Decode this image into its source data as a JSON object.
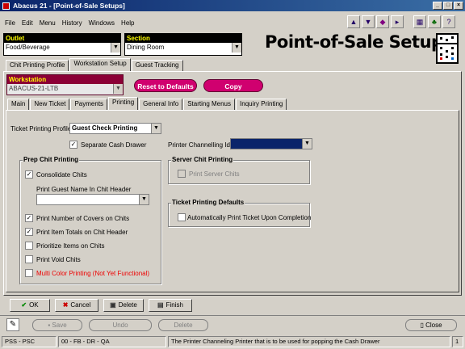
{
  "window": {
    "title": "Abacus 21 - [Point-of-Sale Setups]"
  },
  "menu": [
    "File",
    "Edit",
    "Menu",
    "History",
    "Windows",
    "Help"
  ],
  "header": {
    "outlet_label": "Outlet",
    "outlet_value": "Food/Beverage",
    "section_label": "Section",
    "section_value": "Dining Room",
    "page_title": "Point-of-Sale Setups"
  },
  "top_tabs": [
    "Chit Printing Profile",
    "Workstation Setup",
    "Guest Tracking"
  ],
  "workstation": {
    "label": "Workstation",
    "value": "ABACUS-21-LTB"
  },
  "actions": {
    "reset": "Reset to Defaults",
    "copy": "Copy"
  },
  "sub_tabs": [
    "Main",
    "New Ticket",
    "Payments",
    "Printing",
    "General Info",
    "Starting Menus",
    "Inquiry Printing"
  ],
  "form": {
    "ticket_profile_label": "Ticket Printing Profile",
    "ticket_profile_value": "Guest Check Printing",
    "separate_cash_drawer": "Separate Cash Drawer",
    "printer_channelling_label": "Printer Channelling Id",
    "prep": {
      "title": "Prep Chit Printing",
      "consolidate": "Consolidate Chits",
      "guest_name_label": "Print Guest Name In Chit Header",
      "covers": "Print Number of Covers on Chits",
      "item_totals": "Print Item Totals on Chit Header",
      "prioritize": "Prioritize Items on Chits",
      "void": "Print Void Chits",
      "multi_color": "Multi Color Printing (Not Yet Functional)"
    },
    "server": {
      "title": "Server Chit Printing",
      "print_server": "Print Server Chits"
    },
    "ticket_defaults": {
      "title": "Ticket Printing Defaults",
      "auto_print": "Automatically Print Ticket Upon Completion"
    }
  },
  "buttons": {
    "ok": "OK",
    "cancel": "Cancel",
    "delete": "Delete",
    "finish": "Finish"
  },
  "bottom_bar": {
    "save": "Save",
    "undo": "Undo",
    "delete": "Delete",
    "close": "Close"
  },
  "status": {
    "mode": "PSS - PSC",
    "code": "00 - FB - DR - QA",
    "message": "The Printer Channeling Printer that is to be used for popping the Cash Drawer",
    "page": "1"
  },
  "colors": {
    "accent": "#d0006f",
    "workstation_label_bg": "#8b0036",
    "title_bar": "#0a246a"
  }
}
